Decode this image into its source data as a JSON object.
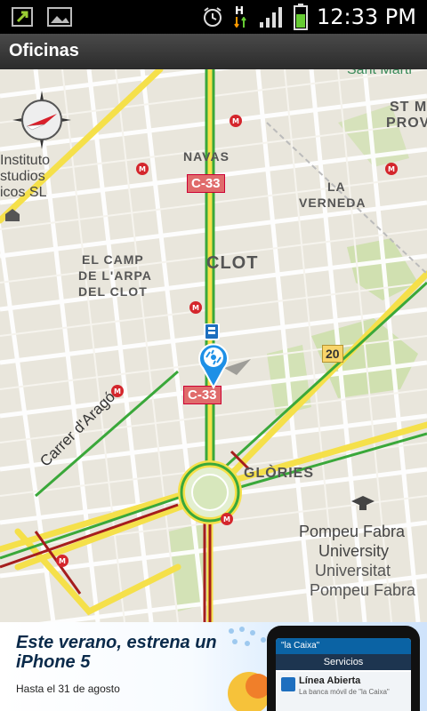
{
  "status_bar": {
    "time": "12:33 PM",
    "network_label": "H"
  },
  "app": {
    "title": "Oficinas"
  },
  "map": {
    "labels": {
      "sant_marti": "Sant Marti",
      "st_m_prov_1": "ST M",
      "st_m_prov_2": "PROV",
      "navas": "NAVAS",
      "la_verneda_1": "LA",
      "la_verneda_2": "VERNEDA",
      "instituto_1": "Instituto",
      "instituto_2": "studios",
      "instituto_3": "icos SL",
      "el_camp_1": "EL CAMP",
      "el_camp_2": "DE L'ARPA",
      "el_camp_3": "DEL CLOT",
      "clot": "CLOT",
      "glories": "GLÒRIES",
      "carrer": "Carrer d'Aragó",
      "pompeu_1": "Pompeu Fabra",
      "pompeu_2": "University",
      "pompeu_3": "Universitat",
      "pompeu_4": "Pompeu Fabra"
    },
    "road_badges": {
      "c33_top": "C-33",
      "c33_bottom": "C-33",
      "road_20": "20"
    }
  },
  "ad": {
    "headline": "Este verano, estrena un iPhone 5",
    "subline": "Hasta el 31 de agosto",
    "phone_brand": "\"la Caixa\"",
    "phone_bar": "Servicios",
    "phone_item_title": "Línea Abierta",
    "phone_item_desc": "La banca móvil de \"la Caixa\""
  }
}
